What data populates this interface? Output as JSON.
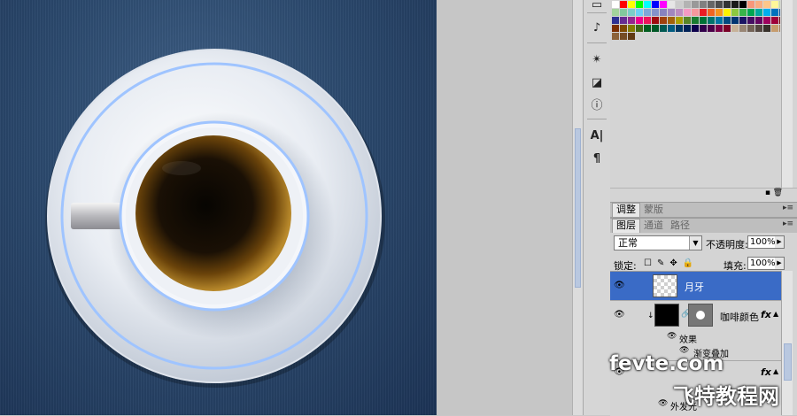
{
  "tabs_adjust": [
    "调整",
    "蒙版"
  ],
  "tabs_layers": [
    "图层",
    "通道",
    "路径"
  ],
  "layers_panel": {
    "blend_mode": "正常",
    "opacity_label": "不透明度:",
    "opacity_value": "100%",
    "lock_label": "锁定:",
    "fill_label": "填充:",
    "fill_value": "100%",
    "layers": [
      {
        "name": "月牙",
        "selected": true
      },
      {
        "name": "咖啡颜色",
        "fx": "fx",
        "effects_label": "效果",
        "effect": "渐变叠加"
      },
      {
        "name": "",
        "fx": "fx",
        "effect": "外发光"
      }
    ]
  },
  "watermark": {
    "line1": "fevte.com",
    "line2": "飞特教程网"
  },
  "swatch_colors": [
    "#ffffff",
    "#ff0000",
    "#ffff00",
    "#00ff00",
    "#00ffff",
    "#0000ff",
    "#ff00ff",
    "#e6e6e6",
    "#cccccc",
    "#b3b3b3",
    "#999999",
    "#808080",
    "#666666",
    "#4d4d4d",
    "#333333",
    "#1a1a1a",
    "#000000",
    "#f7977a",
    "#f9ad81",
    "#fdc68a",
    "#fff79a",
    "#c4df9b",
    "#a3d39c",
    "#82ca9d",
    "#7bcdc8",
    "#6ecff6",
    "#7ea7d8",
    "#8493ca",
    "#8882be",
    "#a187be",
    "#bc8dbf",
    "#f49ac2",
    "#f6989d",
    "#ed1c24",
    "#f26522",
    "#f7941d",
    "#fff200",
    "#8dc73f",
    "#39b54a",
    "#00a651",
    "#00a99d",
    "#00aeef",
    "#0072bc",
    "#0054a6",
    "#2e3192",
    "#662d91",
    "#92278f",
    "#ec008c",
    "#ed145b",
    "#9e0b0f",
    "#a0410d",
    "#a3620a",
    "#aba000",
    "#598527",
    "#197b30",
    "#007236",
    "#00746b",
    "#0076a3",
    "#004a80",
    "#003471",
    "#1b1464",
    "#440e62",
    "#630460",
    "#9e005d",
    "#9e0039",
    "#790000",
    "#7b2e00",
    "#7d4900",
    "#827b00",
    "#406618",
    "#005e20",
    "#005826",
    "#005952",
    "#005b7f",
    "#003663",
    "#002157",
    "#0d004c",
    "#32004b",
    "#4b0049",
    "#7b0046",
    "#7a0026",
    "#c7b299",
    "#998675",
    "#736357",
    "#534741",
    "#37302a",
    "#c69c6d",
    "#a67c52",
    "#8c6239",
    "#754c24",
    "#603913"
  ]
}
